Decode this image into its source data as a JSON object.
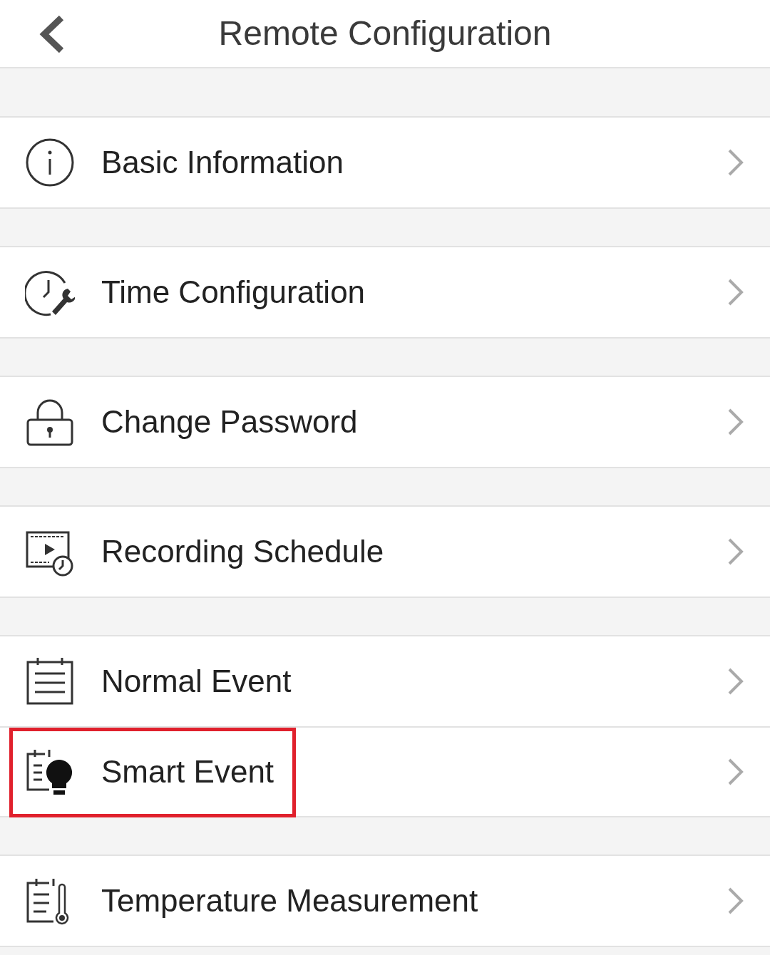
{
  "header": {
    "title": "Remote Configuration"
  },
  "groups": [
    {
      "items": [
        {
          "label": "Basic Information",
          "highlighted": false
        }
      ]
    },
    {
      "items": [
        {
          "label": "Time Configuration",
          "highlighted": false
        }
      ]
    },
    {
      "items": [
        {
          "label": "Change Password",
          "highlighted": false
        }
      ]
    },
    {
      "items": [
        {
          "label": "Recording Schedule",
          "highlighted": false
        }
      ]
    },
    {
      "items": [
        {
          "label": "Normal Event",
          "highlighted": false
        },
        {
          "label": "Smart Event",
          "highlighted": true
        }
      ]
    },
    {
      "items": [
        {
          "label": "Temperature Measurement",
          "highlighted": false
        }
      ]
    }
  ]
}
